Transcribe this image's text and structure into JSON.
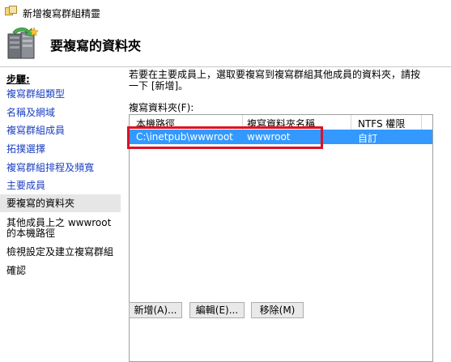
{
  "window": {
    "title": "新增複寫群組精靈"
  },
  "header": {
    "title": "要複寫的資料夾"
  },
  "sidebar": {
    "steps_label": "步驟:",
    "items": [
      {
        "label": "複寫群組類型"
      },
      {
        "label": "名稱及網域"
      },
      {
        "label": "複寫群組成員"
      },
      {
        "label": "拓撲選擇"
      },
      {
        "label": "複寫群組排程及頻寬"
      },
      {
        "label": "主要成員"
      },
      {
        "label": "要複寫的資料夾"
      },
      {
        "label": "其他成員上之 wwwroot 的本機路徑"
      },
      {
        "label": "檢視設定及建立複寫群組"
      },
      {
        "label": "確認"
      }
    ]
  },
  "main": {
    "instruction": "若要在主要成員上，選取要複寫到複寫群組其他成員的資料夾，請按一下 [新增]。",
    "list_label": "複寫資料夾(F):",
    "columns": [
      "本機路徑",
      "複寫資料夾名稱",
      "NTFS 權限"
    ],
    "rows": [
      {
        "local_path": "C:\\inetpub\\wwwroot",
        "folder_name": "wwwroot",
        "ntfs": "自訂"
      }
    ],
    "buttons": {
      "add": "新增(A)...",
      "edit": "編輯(E)...",
      "remove": "移除(M)"
    }
  },
  "colors": {
    "selection": "#3399ff",
    "link": "#1a3ec2",
    "highlight_box": "#dd1122"
  }
}
